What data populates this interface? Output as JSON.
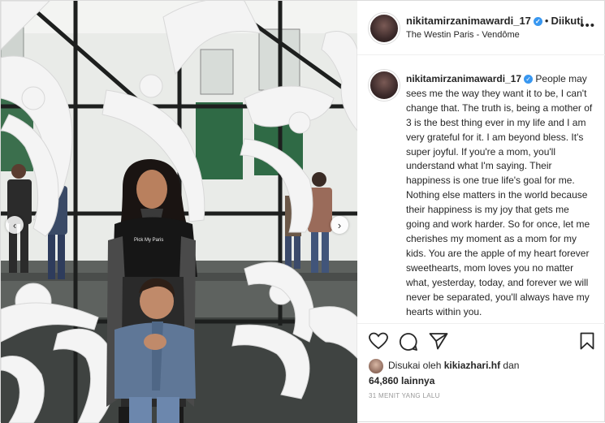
{
  "header": {
    "username": "nikitamirzanimawardi_17",
    "separator": "•",
    "follow_status": "Diikuti",
    "location": "The Westin Paris - Vendôme",
    "more_icon": "ellipsis-icon",
    "verified_icon": "verified-badge-icon"
  },
  "caption": {
    "username": "nikitamirzanimawardi_17",
    "text": "People may sees me the way they want it to be, I can't change that. The truth is, being a mother of 3 is the best thing ever in my life and I am very grateful for it. I am beyond bless. It's super joyful. If you're a mom, you'll understand what I'm saying. Their happiness is one true life's goal for me. Nothing else matters in the world because their happiness is my joy that gets me going and work harder. So for once, let me cherishes my moment as a mom for my kids. You are the apple of my heart forever sweethearts, mom loves you no matter what, yesterday, today, and forever we will never be separated, you'll always have my hearts within you."
  },
  "photo": {
    "shirt_text": "Pick My Paris",
    "prev_arrow": "‹",
    "next_arrow": "›"
  },
  "likes": {
    "prefix": "Disukai oleh",
    "user": "kikiazhari.hf",
    "connector": "dan",
    "count": "64,860",
    "suffix": "lainnya"
  },
  "timestamp": "31 MENIT YANG LALU",
  "colors": {
    "accent": "#3897f0",
    "text": "#262626",
    "muted": "#999999"
  }
}
